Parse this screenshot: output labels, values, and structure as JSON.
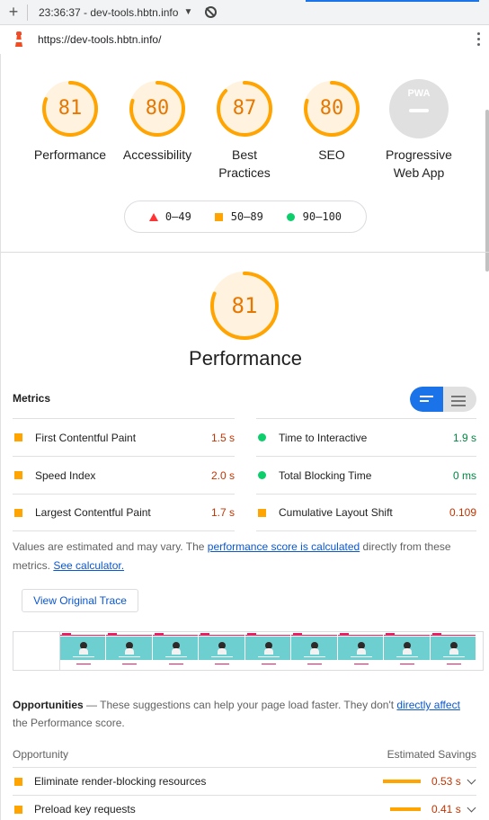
{
  "browser": {
    "time_title": "23:36:37 - dev-tools.hbtn.info",
    "url": "https://dev-tools.hbtn.info/"
  },
  "colors": {
    "average": "#ffa400",
    "average_text": "#e67700",
    "pass": "#0cce6b",
    "fail": "#ff3333",
    "link": "#0b57d0"
  },
  "summary": {
    "gauges": [
      {
        "score": "81",
        "value": 81,
        "label": "Performance"
      },
      {
        "score": "80",
        "value": 80,
        "label": "Accessibility"
      },
      {
        "score": "87",
        "value": 87,
        "label": "Best Practices"
      },
      {
        "score": "80",
        "value": 80,
        "label": "SEO"
      }
    ],
    "pwa": {
      "badge": "PWA",
      "label": "Progressive Web App"
    },
    "legend": {
      "fail": "0–49",
      "average": "50–89",
      "pass": "90–100"
    }
  },
  "performance": {
    "score": "81",
    "value": 81,
    "title": "Performance",
    "metrics_heading": "Metrics",
    "metrics": [
      {
        "name": "First Contentful Paint",
        "value": "1.5 s",
        "status": "average"
      },
      {
        "name": "Time to Interactive",
        "value": "1.9 s",
        "status": "pass"
      },
      {
        "name": "Speed Index",
        "value": "2.0 s",
        "status": "average"
      },
      {
        "name": "Total Blocking Time",
        "value": "0 ms",
        "status": "pass"
      },
      {
        "name": "Largest Contentful Paint",
        "value": "1.7 s",
        "status": "average"
      },
      {
        "name": "Cumulative Layout Shift",
        "value": "0.109",
        "status": "average"
      }
    ],
    "note": {
      "prefix": "Values are estimated and may vary. The ",
      "link1": "performance score is calculated",
      "middle": " directly from these metrics. ",
      "link2": "See calculator."
    },
    "trace_button": "View Original Trace"
  },
  "opportunities": {
    "heading": "Opportunities",
    "desc_prefix": " — These suggestions can help your page load faster. They don't ",
    "desc_link": "directly affect",
    "desc_suffix": " the Performance score.",
    "col_left": "Opportunity",
    "col_right": "Estimated Savings",
    "items": [
      {
        "name": "Eliminate render-blocking resources",
        "savings": "0.53 s"
      },
      {
        "name": "Preload key requests",
        "savings": "0.41 s"
      }
    ]
  }
}
